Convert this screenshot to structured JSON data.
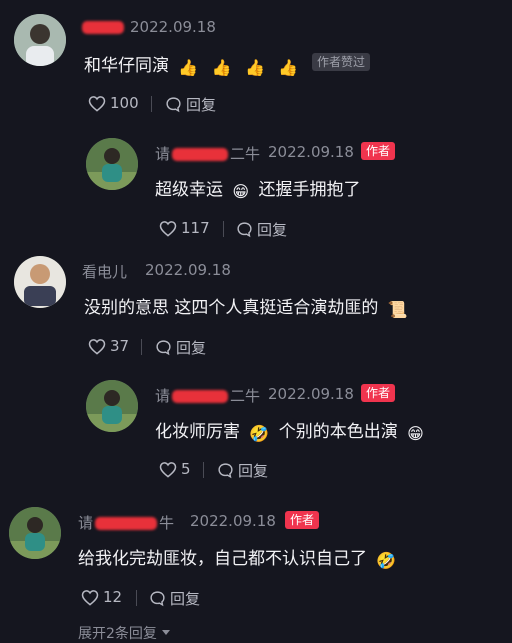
{
  "comments": [
    {
      "date": "2022.09.18",
      "text_before": "和华仔同演",
      "emojis": [
        "👍",
        "👍",
        "👍",
        "👍"
      ],
      "badge": "作者赞过",
      "likes": "100",
      "reply_label": "回复"
    },
    {
      "name_prefix": "请",
      "name_suffix": "二牛",
      "date": "2022.09.18",
      "badge": "作者",
      "text_a": "超级幸运",
      "emoji_a": "😁",
      "text_b": "还握手拥抱了",
      "likes": "117",
      "reply_label": "回复"
    },
    {
      "name_visible": "看电儿",
      "date": "2022.09.18",
      "text_before": "没别的意思 这四个人真挺适合演劫匪的",
      "emoji_a": "📜",
      "likes": "37",
      "reply_label": "回复"
    },
    {
      "name_prefix": "请",
      "name_suffix": "二牛",
      "date": "2022.09.18",
      "badge": "作者",
      "text_a": "化妆师厉害",
      "emoji_a": "🤣",
      "text_b": "个别的本色出演",
      "emoji_b": "😁",
      "likes": "5",
      "reply_label": "回复"
    },
    {
      "name_prefix": "请",
      "name_suffix": "牛",
      "date": "2022.09.18",
      "badge": "作者",
      "text_a": "给我化完劫匪妆，自己都不认识自己了",
      "emoji_a": "🤣",
      "likes": "12",
      "reply_label": "回复"
    }
  ],
  "expand_label": "展开2条回复",
  "icons": [
    "heart-icon",
    "comment-bubble-icon",
    "chevron-down-icon"
  ],
  "colors": {
    "background": "#15161f",
    "author_badge": "#f0344e",
    "redaction": "#e8313a"
  }
}
